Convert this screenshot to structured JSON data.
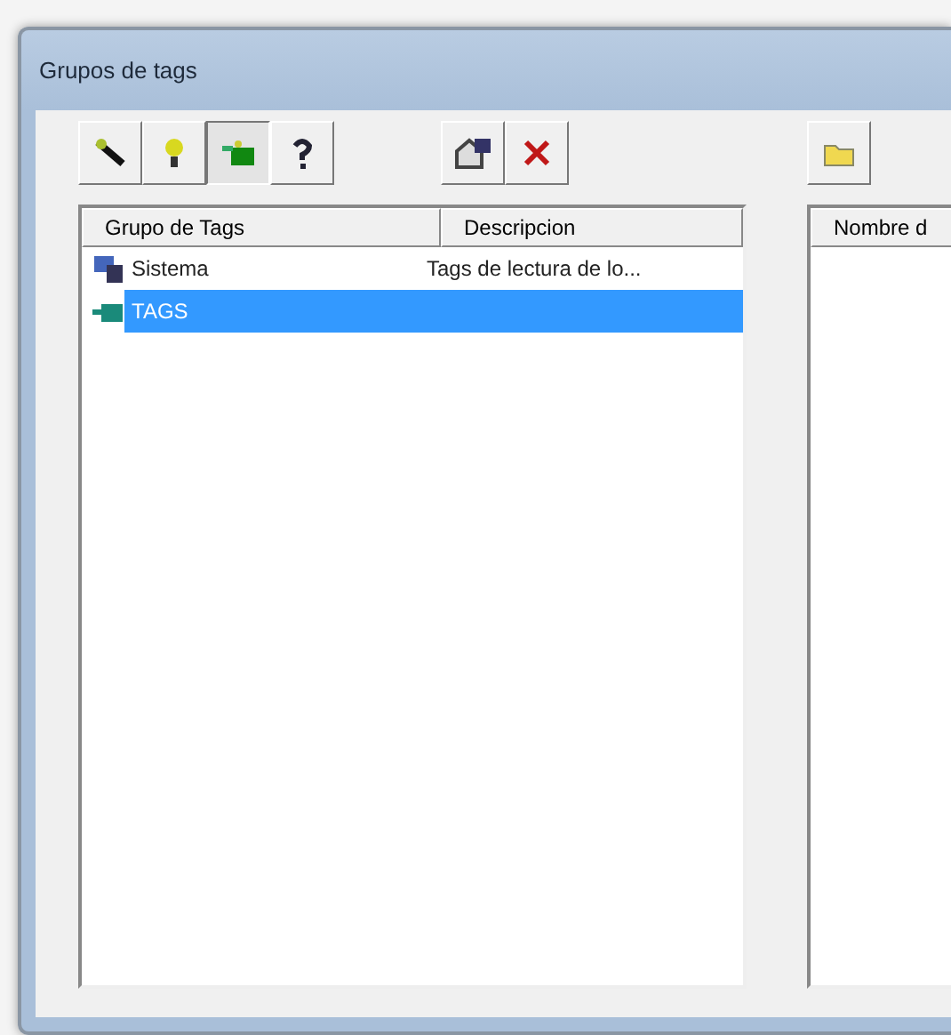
{
  "window": {
    "title": "Grupos de tags"
  },
  "toolbar_left": [
    {
      "kind": "wand",
      "pressed": false
    },
    {
      "kind": "bulb",
      "pressed": false
    },
    {
      "kind": "group",
      "pressed": true
    },
    {
      "kind": "help",
      "pressed": false
    }
  ],
  "toolbar_mid": [
    {
      "kind": "properties",
      "pressed": false
    },
    {
      "kind": "delete",
      "pressed": false
    }
  ],
  "toolbar_right": [
    {
      "kind": "folder",
      "pressed": false
    }
  ],
  "groups_table": {
    "columns": [
      "Grupo de Tags",
      "Descripcion"
    ],
    "rows": [
      {
        "kind": "system",
        "name": "Sistema",
        "description": "Tags de lectura de lo...",
        "selected": false
      },
      {
        "kind": "tags",
        "name": "TAGS",
        "selected": true
      }
    ]
  },
  "tags_table": {
    "columns": [
      "Nombre d"
    ]
  }
}
